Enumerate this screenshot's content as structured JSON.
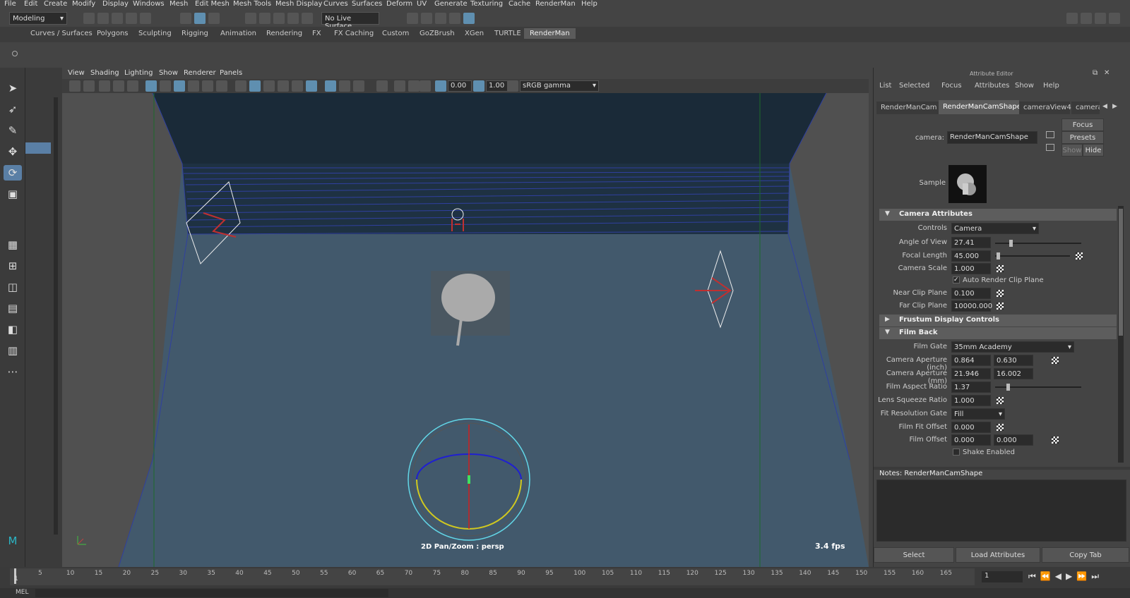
{
  "menu": [
    "File",
    "Edit",
    "Create",
    "Modify",
    "Display",
    "Windows",
    "Mesh",
    "Edit Mesh",
    "Mesh Tools",
    "Mesh Display",
    "Curves",
    "Surfaces",
    "Deform",
    "UV",
    "Generate",
    "Texturing",
    "Cache",
    "RenderMan",
    "Help"
  ],
  "status": {
    "mode": "Modeling",
    "live_surface": "No Live Surface"
  },
  "shelf_tabs": [
    "Curves / Surfaces",
    "Polygons",
    "Sculpting",
    "Rigging",
    "Animation",
    "Rendering",
    "FX",
    "FX Caching",
    "Custom",
    "GoZBrush",
    "XGen",
    "TURTLE",
    "RenderMan"
  ],
  "viewport": {
    "menu": [
      "View",
      "Shading",
      "Lighting",
      "Show",
      "Renderer",
      "Panels"
    ],
    "exposure": "0.00",
    "gamma": "1.00",
    "colorspace": "sRGB gamma",
    "hud_label": "2D Pan/Zoom : persp",
    "fps": "3.4 fps",
    "cam_label": "persp"
  },
  "ae": {
    "menu": [
      "List",
      "Selected",
      "Focus",
      "Attributes",
      "Show",
      "Help"
    ],
    "tabs": [
      "RenderManCam",
      "RenderManCamShape",
      "cameraView4",
      "cameraV"
    ],
    "focus": "Focus",
    "presets": "Presets",
    "show": "Show",
    "hide": "Hide",
    "camera_label": "camera:",
    "camera_value": "RenderManCamShape",
    "sample_label": "Sample",
    "sections": {
      "cam_attrs": "Camera Attributes",
      "frustum": "Frustum Display Controls",
      "film_back": "Film Back"
    },
    "rows": {
      "controls_l": "Controls",
      "controls_v": "Camera",
      "aov_l": "Angle of View",
      "aov_v": "27.41",
      "fl_l": "Focal Length",
      "fl_v": "45.000",
      "cs_l": "Camera Scale",
      "cs_v": "1.000",
      "arcp": "Auto Render Clip Plane",
      "ncp_l": "Near Clip Plane",
      "ncp_v": "0.100",
      "fcp_l": "Far Clip Plane",
      "fcp_v": "10000.000",
      "fg_l": "Film Gate",
      "fg_v": "35mm Academy",
      "cai_l": "Camera Aperture (inch)",
      "cai_v1": "0.864",
      "cai_v2": "0.630",
      "cam_l": "Camera Aperture (mm)",
      "cam_v1": "21.946",
      "cam_v2": "16.002",
      "far_l": "Film Aspect Ratio",
      "far_v": "1.37",
      "lsr_l": "Lens Squeeze Ratio",
      "lsr_v": "1.000",
      "frg_l": "Fit Resolution Gate",
      "frg_v": "Fill",
      "ffo_l": "Film Fit Offset",
      "ffo_v": "0.000",
      "fo_l": "Film Offset",
      "fo_v1": "0.000",
      "fo_v2": "0.000",
      "shake": "Shake Enabled"
    },
    "notes_label": "Notes:  RenderManCamShape",
    "select": "Select",
    "load": "Load Attributes",
    "copy": "Copy Tab"
  },
  "timeline": {
    "ticks": [
      "5",
      "10",
      "15",
      "20",
      "25",
      "30",
      "35",
      "40",
      "45",
      "50",
      "55",
      "60",
      "65",
      "70",
      "75",
      "80",
      "85",
      "90",
      "95",
      "100",
      "105",
      "110",
      "115",
      "120",
      "125",
      "130",
      "135",
      "140",
      "145",
      "150",
      "155",
      "160",
      "165"
    ],
    "start": "1",
    "current": "1",
    "mel": "MEL"
  }
}
